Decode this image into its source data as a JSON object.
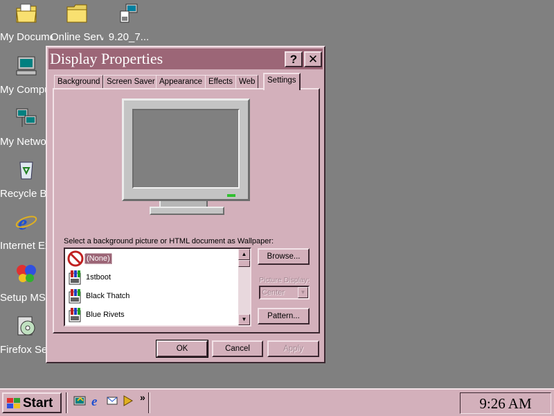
{
  "desktop": {
    "icons": [
      {
        "label": "My Documents",
        "icon": "folder-documents-icon"
      },
      {
        "label": "Online Services",
        "icon": "folder-icon"
      },
      {
        "label": "9.20_7...",
        "icon": "network-file-icon"
      },
      {
        "label": "My Computer",
        "icon": "computer-icon"
      },
      {
        "label": "My Network Places",
        "icon": "network-icon"
      },
      {
        "label": "Recycle Bin",
        "icon": "recycle-bin-icon"
      },
      {
        "label": "Internet Explorer",
        "icon": "ie-icon"
      },
      {
        "label": "Setup MSN I...",
        "icon": "msn-butterfly-icon"
      },
      {
        "label": "Firefox Setup...",
        "icon": "setup-disc-icon"
      }
    ]
  },
  "window": {
    "title": "Display Properties",
    "help_label": "?",
    "close_label": "✕",
    "tabs": [
      {
        "label": "Background"
      },
      {
        "label": "Screen Saver"
      },
      {
        "label": "Appearance"
      },
      {
        "label": "Effects"
      },
      {
        "label": "Web"
      },
      {
        "label": "Settings"
      }
    ],
    "active_tab": "Settings",
    "wallpaper_caption": "Select a background picture or HTML document as Wallpaper:",
    "wallpaper_list": [
      {
        "label": "(None)",
        "selected": true,
        "icon": "none-icon"
      },
      {
        "label": "1stboot",
        "selected": false,
        "icon": "paint-icon"
      },
      {
        "label": "Black Thatch",
        "selected": false,
        "icon": "paint-icon"
      },
      {
        "label": "Blue Rivets",
        "selected": false,
        "icon": "paint-icon"
      }
    ],
    "browse_label": "Browse...",
    "picture_display_label": "Picture Display:",
    "picture_display_value": "Center",
    "pattern_label": "Pattern...",
    "ok_label": "OK",
    "cancel_label": "Cancel",
    "apply_label": "Apply"
  },
  "taskbar": {
    "start_label": "Start",
    "quick_launch": [
      "desktop-icon",
      "ie-icon",
      "outlook-icon",
      "channels-icon"
    ],
    "overflow_label": "»",
    "clock": "9:26 AM"
  },
  "colors": {
    "desktop": "#808080",
    "face": "#d3b0bb",
    "titlebar": "#9c6677",
    "highlight": "#9c6677"
  }
}
